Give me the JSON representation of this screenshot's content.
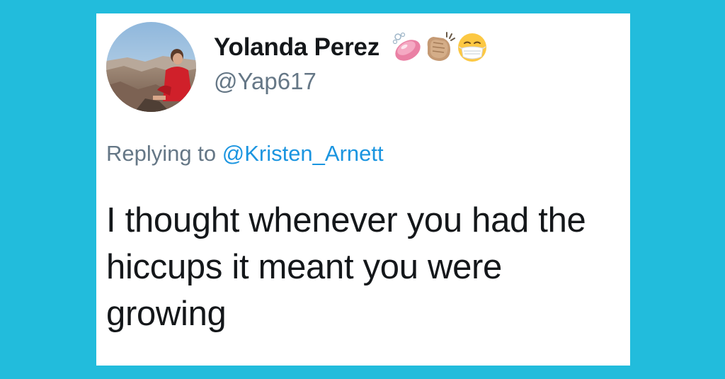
{
  "tweet": {
    "display_name": "Yolanda Perez",
    "handle": "@Yap617",
    "name_emojis": [
      "soap-emoji",
      "clapping-hands-emoji",
      "face-with-medical-mask-emoji"
    ],
    "reply_prefix": "Replying to",
    "reply_to": "@Kristen_Arnett",
    "text": "I thought whenever you had the hiccups it meant you were growing"
  },
  "colors": {
    "background": "#22bcdc",
    "card": "#ffffff",
    "name_text": "#14171a",
    "secondary_text": "#657786",
    "mention_link": "#1b95e0"
  }
}
